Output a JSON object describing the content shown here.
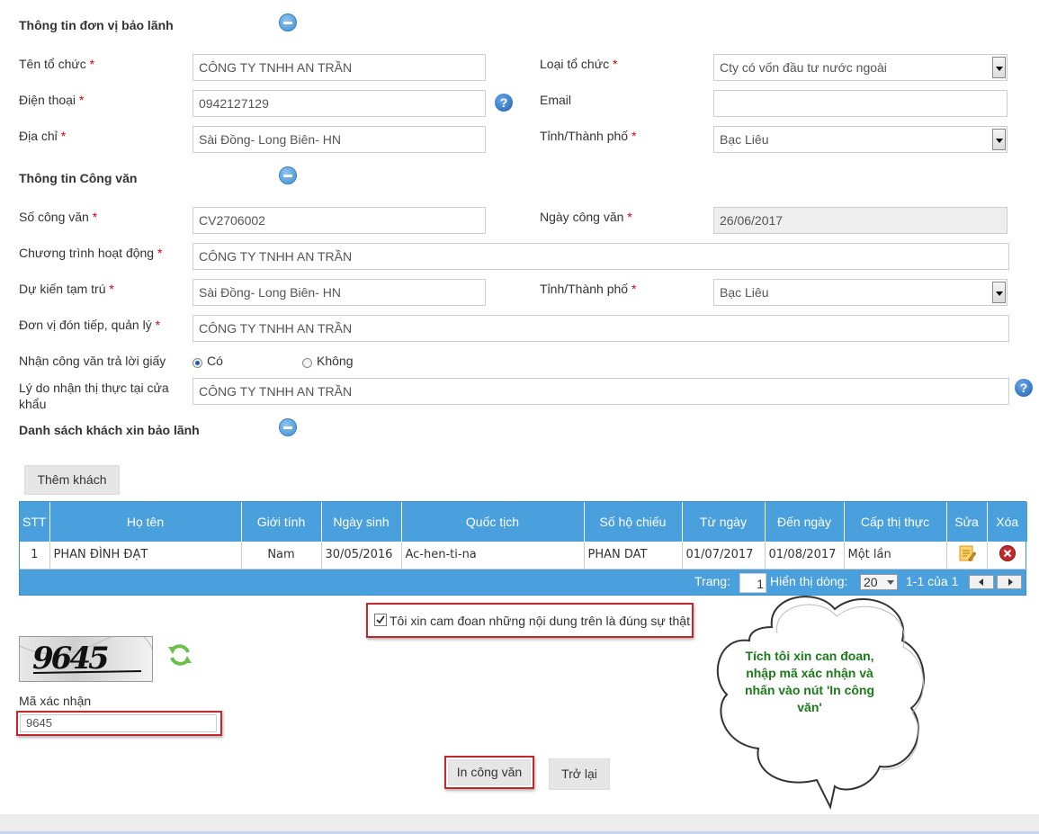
{
  "sections": {
    "guarantor_title": "Thông tin đơn vị bảo lãnh",
    "document_title": "Thông tin Công văn",
    "guests_title": "Danh sách khách xin bảo lãnh"
  },
  "guarantor": {
    "org_name_label": "Tên tổ chức",
    "org_name_value": "CÔNG TY TNHH AN TRẦN",
    "org_type_label": "Loại tổ chức",
    "org_type_value": "Cty có vốn đầu tư nước ngoài",
    "phone_label": "Điện thoại",
    "phone_value": "0942127129",
    "email_label": "Email",
    "email_value": "",
    "address_label": "Địa chỉ",
    "address_value": "Sài Đồng- Long Biên- HN",
    "province_label": "Tỉnh/Thành phố",
    "province_value": "Bạc Liêu"
  },
  "document": {
    "doc_number_label": "Số công văn",
    "doc_number_value": "CV2706002",
    "doc_date_label": "Ngày công văn",
    "doc_date_value": "26/06/2017",
    "program_label": "Chương trình hoạt động",
    "program_value": "CÔNG TY TNHH AN TRẦN",
    "stay_label": "Dự kiến tạm trú",
    "stay_value": "Sài Đồng- Long Biên- HN",
    "stay_province_label": "Tỉnh/Thành phố",
    "stay_province_value": "Bạc Liêu",
    "host_label": "Đơn vị đón tiếp, quản lý",
    "host_value": "CÔNG TY TNHH AN TRẦN",
    "reply_label": "Nhận công văn trả lời giấy",
    "reply_yes": "Có",
    "reply_no": "Không",
    "reason_label_1": "Lý do nhận thị thực tại cửa",
    "reason_label_2": "khẩu",
    "reason_value": "CÔNG TY TNHH AN TRẦN"
  },
  "required_mark": "*",
  "help_mark": "?",
  "add_guest_label": "Thêm khách",
  "grid": {
    "columns": [
      "STT",
      "Họ tên",
      "Giới tính",
      "Ngày sinh",
      "Quốc tịch",
      "Số hộ chiếu",
      "Từ ngày",
      "Đến ngày",
      "Cấp thị thực",
      "Sửa",
      "Xóa"
    ],
    "rows": [
      [
        "1",
        "PHAN ĐÌNH ĐẠT",
        "Nam",
        "30/05/2016",
        "Ac-hen-ti-na",
        "PHAN DAT",
        "01/07/2017",
        "01/08/2017",
        "Một lần"
      ]
    ],
    "pager": {
      "page_label": "Trang:",
      "page_value": "1",
      "rows_label": "Hiển thị dòng:",
      "rows_value": "20",
      "summary": "1-1 của 1"
    }
  },
  "commit_label": "Tôi xin cam đoan những nội dung trên là đúng sự thật",
  "captcha": {
    "image_text": "9645",
    "label": "Mã xác nhận",
    "value": "9645"
  },
  "buttons": {
    "print": "In công văn",
    "back": "Trở lại"
  },
  "callout": {
    "line1": "Tích tôi xin can đoan,",
    "line2": "nhập mã xác nhận và",
    "line3": "nhấn vào nút 'In công",
    "line4": "văn'"
  },
  "colors": {
    "grid_header": "#4aa0dc",
    "highlight": "#c0282e",
    "callout_text": "#1a7a1a",
    "callout_fill": "#ffffff"
  }
}
